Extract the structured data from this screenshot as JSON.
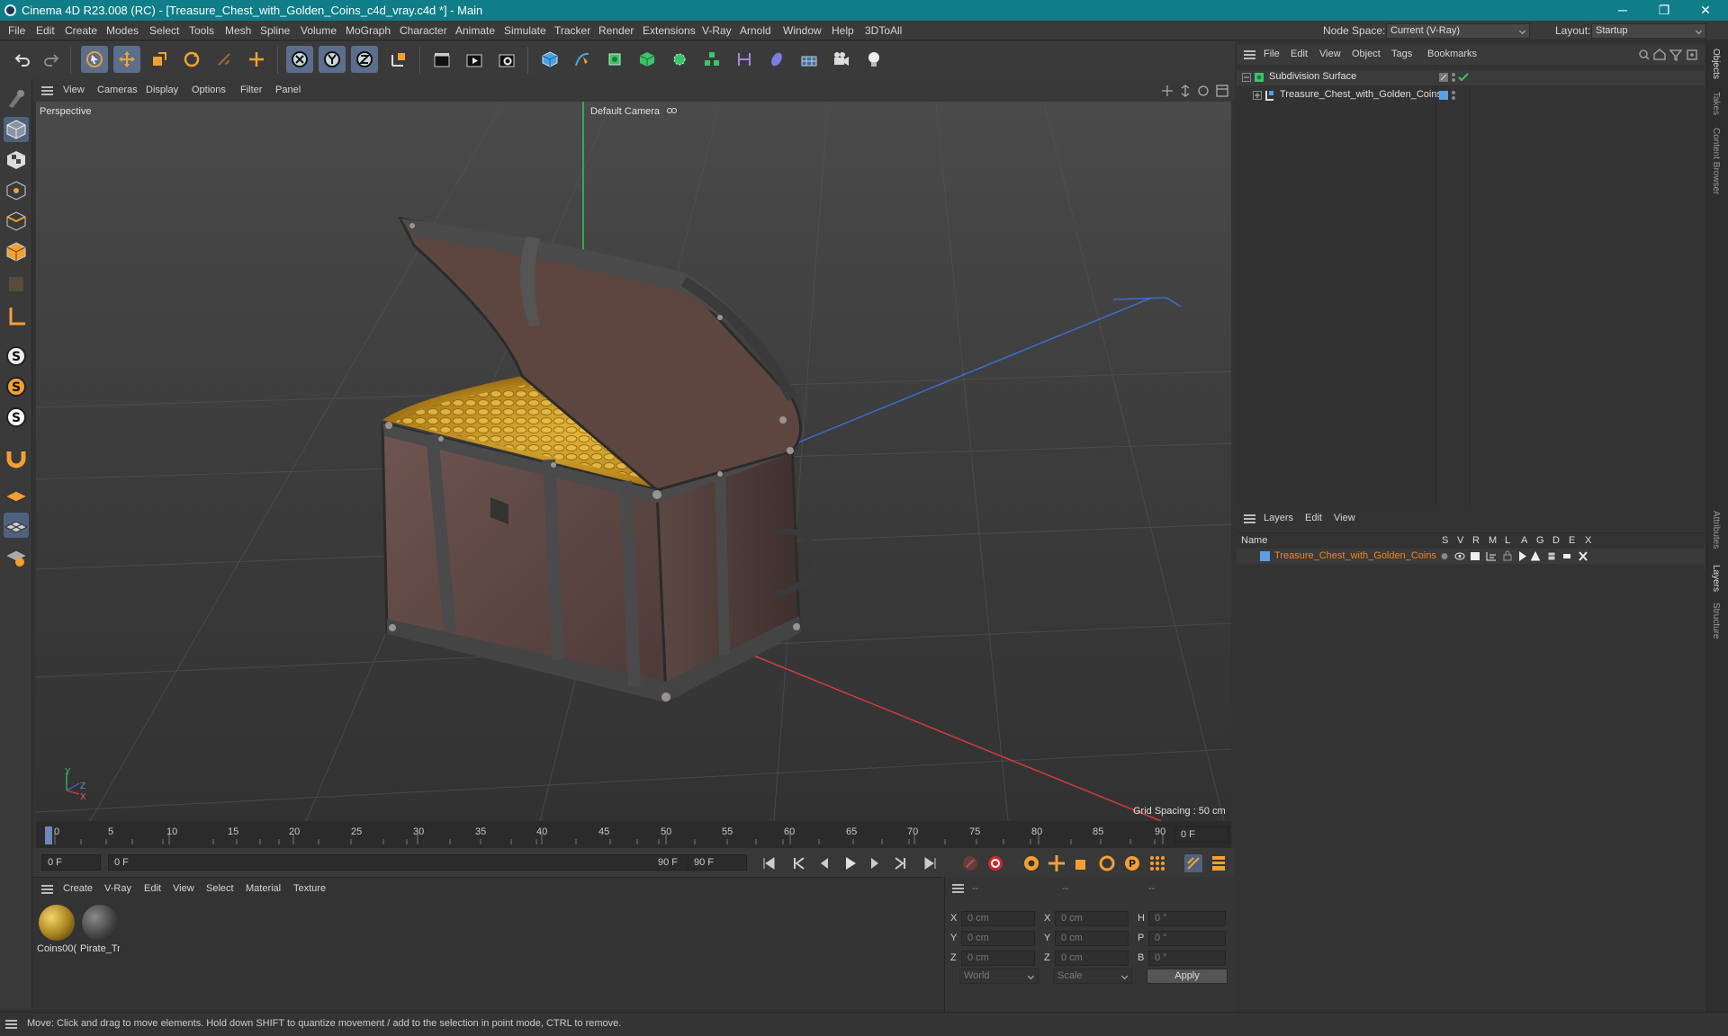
{
  "window": {
    "title": "Cinema 4D R23.008 (RC) - [Treasure_Chest_with_Golden_Coins_c4d_vray.c4d *] - Main",
    "minimize": "─",
    "maximize": "❐",
    "close": "✕"
  },
  "menubar": {
    "items": [
      "File",
      "Edit",
      "Create",
      "Modes",
      "Select",
      "Tools",
      "Mesh",
      "Spline",
      "Volume",
      "MoGraph",
      "Character",
      "Animate",
      "Simulate",
      "Tracker",
      "Render",
      "Extensions",
      "V-Ray",
      "Arnold",
      "Window",
      "Help",
      "3DToAll"
    ],
    "node_space_label": "Node Space:",
    "node_space_value": "Current (V-Ray)",
    "layout_label": "Layout:",
    "layout_value": "Startup"
  },
  "viewport": {
    "menu": [
      "View",
      "Cameras",
      "Display",
      "Options",
      "Filter",
      "Panel"
    ],
    "projection": "Perspective",
    "camera": "Default Camera",
    "grid_spacing": "Grid Spacing : 50 cm",
    "axis_y": "Y",
    "axis_z": "Z",
    "axis_x": "X"
  },
  "timeline": {
    "ticks": [
      "0",
      "5",
      "10",
      "15",
      "20",
      "25",
      "30",
      "35",
      "40",
      "45",
      "50",
      "55",
      "60",
      "65",
      "70",
      "75",
      "80",
      "85",
      "90"
    ],
    "current_frame": "0 F"
  },
  "playbar": {
    "start": "0 F",
    "range_start": "0 F",
    "range_end": "90 F",
    "end": "90 F"
  },
  "material_panel": {
    "menu": [
      "Create",
      "V-Ray",
      "Edit",
      "View",
      "Select",
      "Material",
      "Texture"
    ],
    "materials": [
      {
        "name": "Coins00("
      },
      {
        "name": "Pirate_Tr"
      }
    ]
  },
  "coords": {
    "headers": [
      "--",
      "--",
      "--"
    ],
    "rows": [
      {
        "l1": "X",
        "v1": "0 cm",
        "l2": "X",
        "v2": "0 cm",
        "l3": "H",
        "v3": "0 °"
      },
      {
        "l1": "Y",
        "v1": "0 cm",
        "l2": "Y",
        "v2": "0 cm",
        "l3": "P",
        "v3": "0 °"
      },
      {
        "l1": "Z",
        "v1": "0 cm",
        "l2": "Z",
        "v2": "0 cm",
        "l3": "B",
        "v3": "0 °"
      }
    ],
    "space": "World",
    "mode": "Scale",
    "apply": "Apply"
  },
  "objects": {
    "menu": [
      "File",
      "Edit",
      "View",
      "Object",
      "Tags",
      "Bookmarks"
    ],
    "items": [
      {
        "name": "Subdivision Surface"
      },
      {
        "name": "Treasure_Chest_with_Golden_Coins"
      }
    ]
  },
  "layers": {
    "menu": [
      "Layers",
      "Edit",
      "View"
    ],
    "name_header": "Name",
    "flags": [
      "S",
      "V",
      "R",
      "M",
      "L",
      "A",
      "G",
      "D",
      "E",
      "X"
    ],
    "items": [
      {
        "name": "Treasure_Chest_with_Golden_Coins"
      }
    ],
    "accent": "#f0871e"
  },
  "right_tabs": [
    "Objects",
    "Takes",
    "Content Browser",
    "Attributes",
    "Layers",
    "Structure"
  ],
  "status": "Move: Click and drag to move elements. Hold down SHIFT to quantize movement / add to the selection in point mode, CTRL to remove."
}
